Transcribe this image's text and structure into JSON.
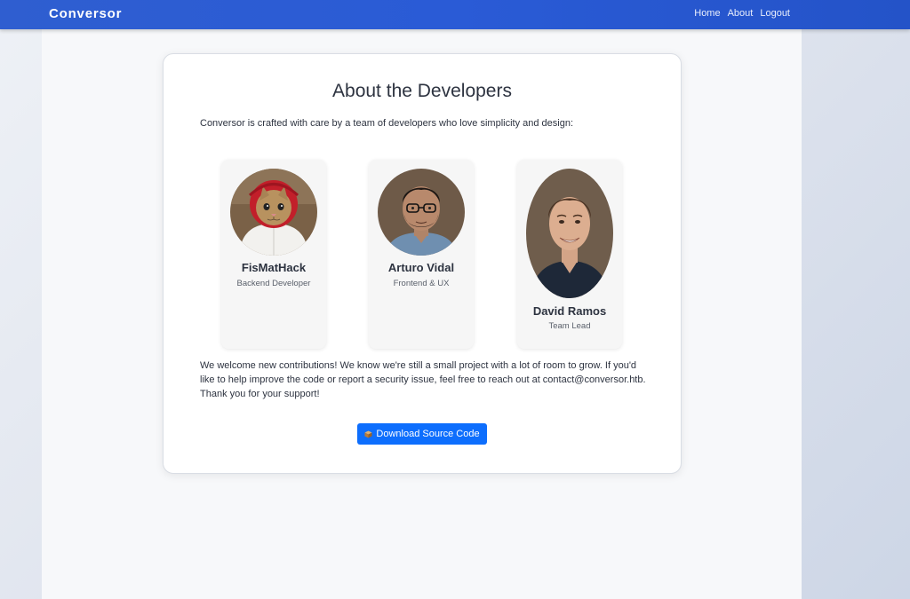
{
  "navbar": {
    "brand": "Conversor",
    "links": [
      "Home",
      "About",
      "Logout"
    ]
  },
  "main": {
    "title": "About the Developers",
    "intro": "Conversor is crafted with care by a team of developers who love simplicity and design:",
    "developers": [
      {
        "name": "FisMatHack",
        "role": "Backend Developer",
        "avatar": "hooded-cat-avatar"
      },
      {
        "name": "Arturo Vidal",
        "role": "Frontend & UX",
        "avatar": "man-with-glasses-avatar"
      },
      {
        "name": "David Ramos",
        "role": "Team Lead",
        "avatar": "smiling-man-avatar"
      }
    ],
    "outro": "We welcome new contributions! We know we're still a small project with a lot of room to grow. If you'd like to help improve the code or report a security issue, feel free to reach out at contact@conversor.htb. Thank you for your support!",
    "download_button": {
      "icon": "package-icon",
      "label": "Download Source Code"
    }
  },
  "colors": {
    "navbar": "#2a5bd6",
    "button": "#0d6efd",
    "text": "#2d3340"
  }
}
